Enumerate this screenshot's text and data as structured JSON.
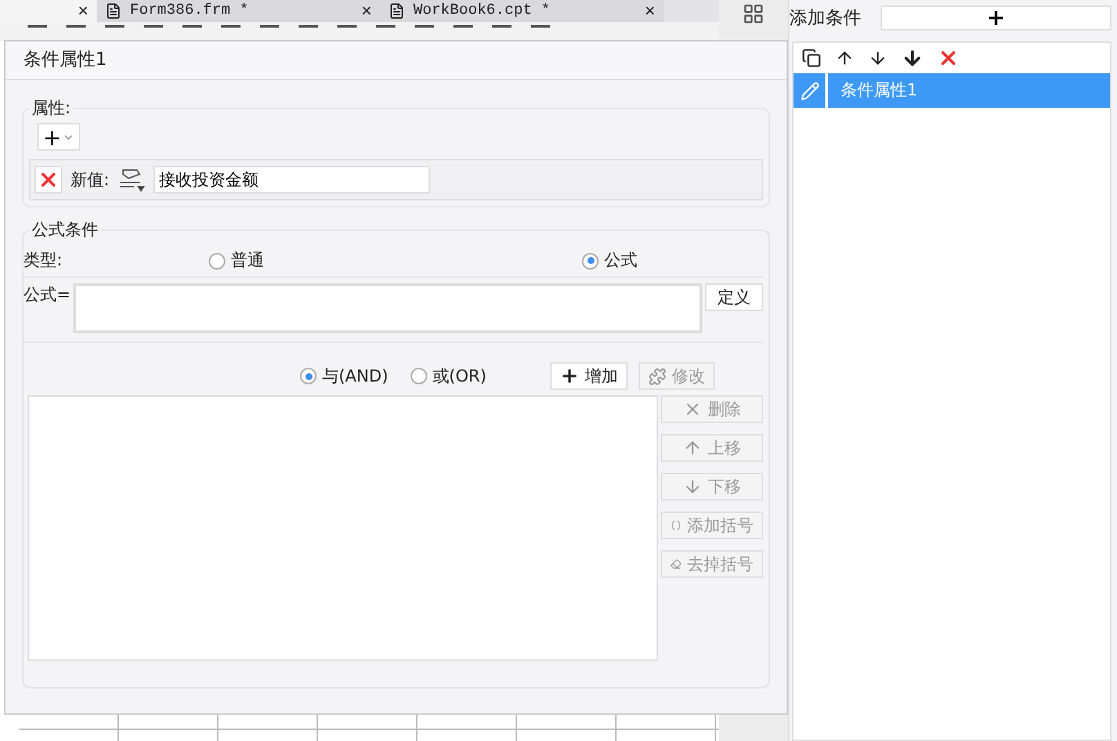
{
  "tabs": [
    {
      "close": "×",
      "selected": true
    },
    {
      "label": "Form386.frm *",
      "close": "×",
      "selected": false
    },
    {
      "label": "WorkBook6.cpt *",
      "close": "×",
      "selected": false
    }
  ],
  "dialog": {
    "title": "条件属性1",
    "properties": {
      "legend": "属性:",
      "add_button": "+",
      "row": {
        "label": "新值:",
        "value": "接收投资金额"
      }
    },
    "formula_condition": {
      "legend": "公式条件",
      "type_label": "类型:",
      "types": [
        {
          "label": "普通",
          "selected": false
        },
        {
          "label": "公式",
          "selected": true
        }
      ],
      "formula_label": "公式=",
      "define_button": "定义",
      "logic": [
        {
          "label": "与(AND)",
          "selected": true
        },
        {
          "label": "或(OR)",
          "selected": false
        }
      ],
      "add_button": {
        "label": "增加",
        "disabled": false
      },
      "modify_button": {
        "label": "修改",
        "disabled": true
      },
      "side_buttons": [
        {
          "kind": "delete",
          "label": "删除",
          "disabled": true
        },
        {
          "kind": "up",
          "label": "上移",
          "disabled": true
        },
        {
          "kind": "down",
          "label": "下移",
          "disabled": true
        },
        {
          "kind": "add-bracket",
          "label": "添加括号",
          "disabled": true
        },
        {
          "kind": "remove-bracket",
          "label": "去掉括号",
          "disabled": true
        }
      ]
    }
  },
  "conditions_panel": {
    "label": "添加条件",
    "add_button": "+",
    "items": [
      {
        "label": "条件属性1",
        "selected": true
      }
    ]
  }
}
